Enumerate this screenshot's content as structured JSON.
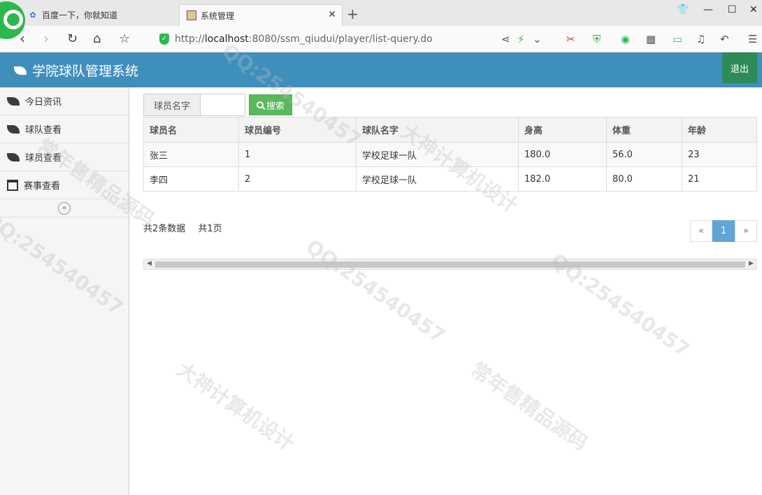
{
  "browser": {
    "tabs": [
      {
        "title": "百度一下，你就知道",
        "active": false
      },
      {
        "title": "系统管理",
        "active": true
      }
    ],
    "url": {
      "prefix": "http://",
      "host": "localhost",
      "rest": ":8080/ssm_qiudui/player/list-query.do"
    }
  },
  "app": {
    "title": "学院球队管理系统",
    "logout_label": "退出"
  },
  "sidebar": {
    "items": [
      {
        "label": "今日资讯",
        "icon": "leaf-icon"
      },
      {
        "label": "球队查看",
        "icon": "leaf-icon"
      },
      {
        "label": "球员查看",
        "icon": "leaf-icon"
      },
      {
        "label": "赛事查看",
        "icon": "calendar-icon"
      }
    ],
    "collapse_glyph": "«"
  },
  "search": {
    "label": "球员名字",
    "value": "",
    "button_label": "搜索"
  },
  "table": {
    "headers": [
      "球员名",
      "球员编号",
      "球队名字",
      "身高",
      "体重",
      "年龄"
    ],
    "rows": [
      [
        "张三",
        "1",
        "学校足球一队",
        "180.0",
        "56.0",
        "23"
      ],
      [
        "李四",
        "2",
        "学校足球一队",
        "182.0",
        "80.0",
        "21"
      ]
    ]
  },
  "summary": {
    "total": "共2条数据",
    "pages": "共1页"
  },
  "pagination": {
    "prev": "«",
    "current": "1",
    "next": "»"
  },
  "watermark": [
    "QQ:254540457",
    "大神计算机设计",
    "常年售精品源码"
  ],
  "colors": {
    "header": "#3f8fbd",
    "logout": "#2e8b57",
    "search_button": "#5cb85c",
    "page_active": "#5fa6d6"
  }
}
